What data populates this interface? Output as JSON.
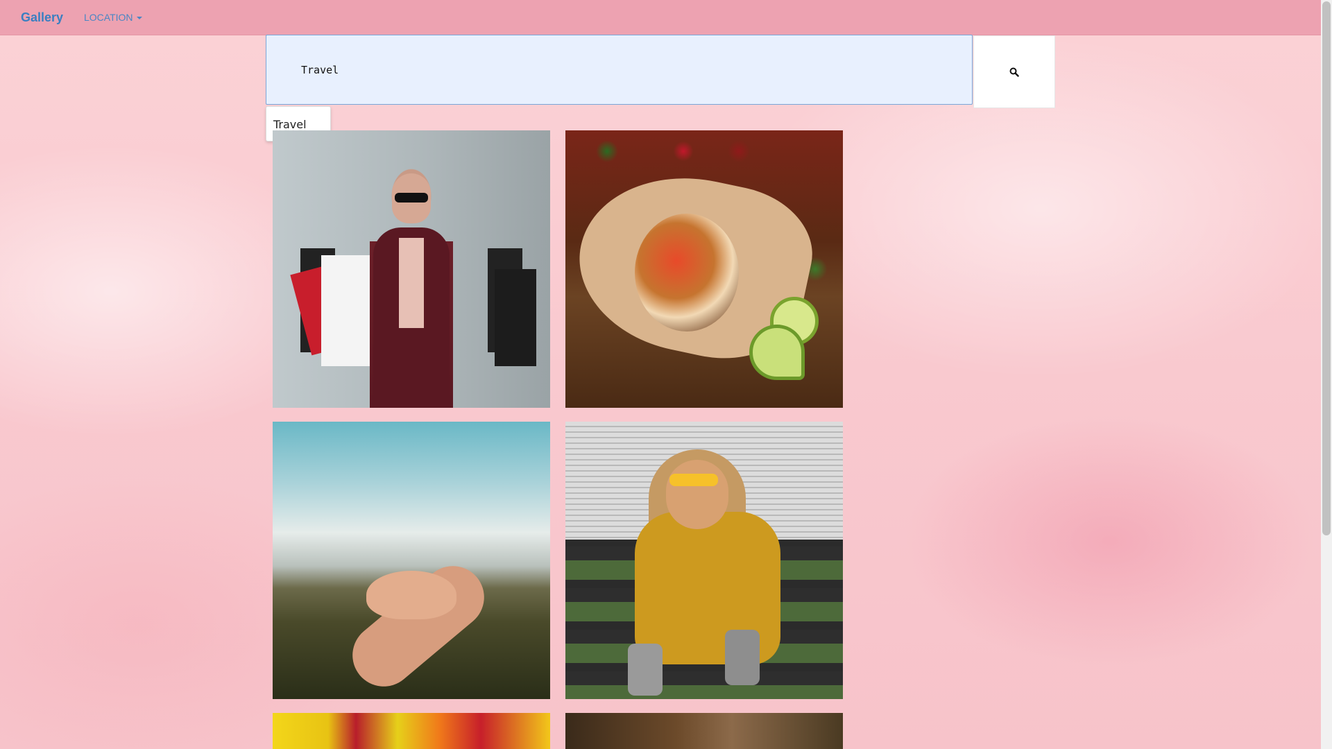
{
  "navbar": {
    "brand": "Gallery",
    "location_label": "LOCATION"
  },
  "search": {
    "value": "Travel",
    "icon": "search-icon"
  },
  "autocomplete": {
    "items": [
      "Travel"
    ]
  },
  "gallery": {
    "photos": [
      {
        "subject": "woman-with-shopping-bags"
      },
      {
        "subject": "burrito-with-limes"
      },
      {
        "subject": "hand-over-landscape"
      },
      {
        "subject": "woman-in-yellow-dress-on-steps"
      },
      {
        "subject": "colorful-paint"
      },
      {
        "subject": "food-close-up"
      }
    ]
  },
  "colors": {
    "navbar_bg": "#eda2b1",
    "brand": "#3a7fc1",
    "input_bg": "#e8f0fe"
  }
}
